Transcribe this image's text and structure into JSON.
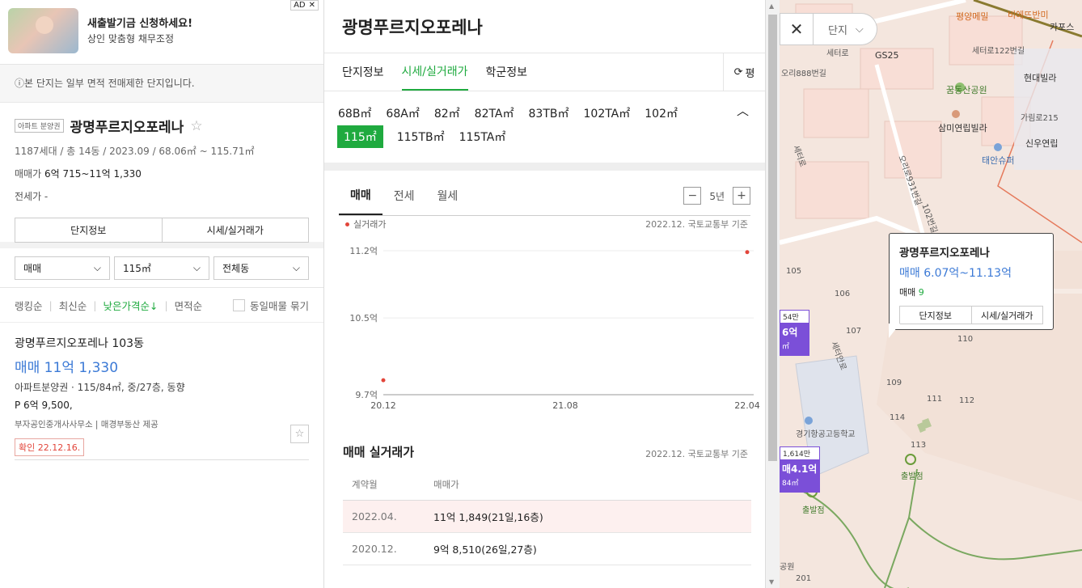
{
  "ad": {
    "title": "새출발기금 신청하세요!",
    "subtitle": "상인 맞춤형 채무조정",
    "badge": "AD",
    "close": "✕"
  },
  "notice": "본 단지는 일부 면적 전매제한 단지입니다.",
  "complex": {
    "tag": "아파트 분양권",
    "name": "광명푸르지오포레나",
    "star": "☆",
    "meta": "1187세대 / 총 14동 / 2023.09 / 68.06㎡ ~ 115.71㎡",
    "sale_label": "매매가",
    "sale_value": "6억 715~11억 1,330",
    "jeonse": "전세가 -",
    "btn_info": "단지정보",
    "btn_price": "시세/실거래가"
  },
  "filters": [
    {
      "label": "매매"
    },
    {
      "label": "115㎡"
    },
    {
      "label": "전체동"
    }
  ],
  "sorts": {
    "items": [
      "랭킹순",
      "최신순",
      "낮은가격순↓",
      "면적순"
    ],
    "active": 2,
    "group_label": "동일매물 묶기"
  },
  "listing": {
    "name": "광명푸르지오포레나 103동",
    "price": "매매 11억 1,330",
    "desc": "아파트분양권 · 115/84㎡, 중/27층, 동향",
    "premium": "P 6억 9,500,",
    "agent": "부자공인중개사사무소  |  매경부동산 제공",
    "confirm": "확인 22.12.16.",
    "star": "☆"
  },
  "detail": {
    "title": "광명푸르지오포레나",
    "tabs": [
      "단지정보",
      "시세/실거래가",
      "학군정보"
    ],
    "active_tab": 1,
    "refresh_label": "평",
    "sizes_row1": [
      "68B㎡",
      "68A㎡",
      "82㎡",
      "82TA㎡",
      "83TB㎡",
      "102TA㎡",
      "102㎡"
    ],
    "sizes_row2": [
      "115㎡",
      "115TB㎡",
      "115TA㎡"
    ],
    "active_size": "115㎡",
    "trade_tabs": [
      "매매",
      "전세",
      "월세"
    ],
    "active_trade": 0,
    "period": "5년",
    "zoom_minus": "−",
    "zoom_plus": "+",
    "legend": "실거래가",
    "source": "2022.12. 국토교통부 기준",
    "section_title": "매매 실거래가",
    "table_headers": [
      "계약월",
      "매매가"
    ],
    "table_rows": [
      [
        "2022.04.",
        "11억 1,849(21일,16층)"
      ],
      [
        "2020.12.",
        "9억 8,510(26일,27층)"
      ]
    ]
  },
  "chart_data": {
    "type": "scatter",
    "title": "",
    "series": [
      {
        "name": "실거래가",
        "color": "#e2453a",
        "points": [
          {
            "x": "2020.12",
            "y": 9.851
          },
          {
            "x": "2022.04",
            "y": 11.1849
          }
        ]
      }
    ],
    "x_ticks": [
      "20.12",
      "21.08",
      "22.04"
    ],
    "y_ticks": [
      "9.7억",
      "10.5억",
      "11.2억"
    ],
    "y_tick_values": [
      9.7,
      10.5,
      11.2
    ],
    "ylim": [
      9.7,
      11.2
    ],
    "grid": true
  },
  "map": {
    "filter_label": "단지",
    "close": "✕",
    "popup": {
      "name": "광명푸르지오포레나",
      "price": "매매 6.07억~11.13억",
      "count_label": "매매",
      "count": "9",
      "btn_info": "단지정보",
      "btn_price": "시세/실거래가"
    },
    "labels": [
      "평양메밀",
      "비에뜨반미",
      "카포스",
      "GS25",
      "세터로122번길",
      "세터로",
      "오리888번길",
      "현대빌라",
      "꿈동산공원",
      "가림로215",
      "삼미연립빌라",
      "신우연립",
      "세터로",
      "태안슈퍼",
      "오리로931번길",
      "102번길",
      "105",
      "106",
      "107",
      "110",
      "109",
      "111",
      "112",
      "114",
      "113",
      "출발점",
      "경기항공고등학교",
      "출발점",
      "세터안로",
      "공원",
      "201"
    ],
    "marker1": {
      "head": "54만",
      "body": "6억",
      "sub": "㎡"
    },
    "marker2": {
      "head": "1,614만",
      "body": "매4.1억",
      "sub": "84㎡"
    }
  }
}
